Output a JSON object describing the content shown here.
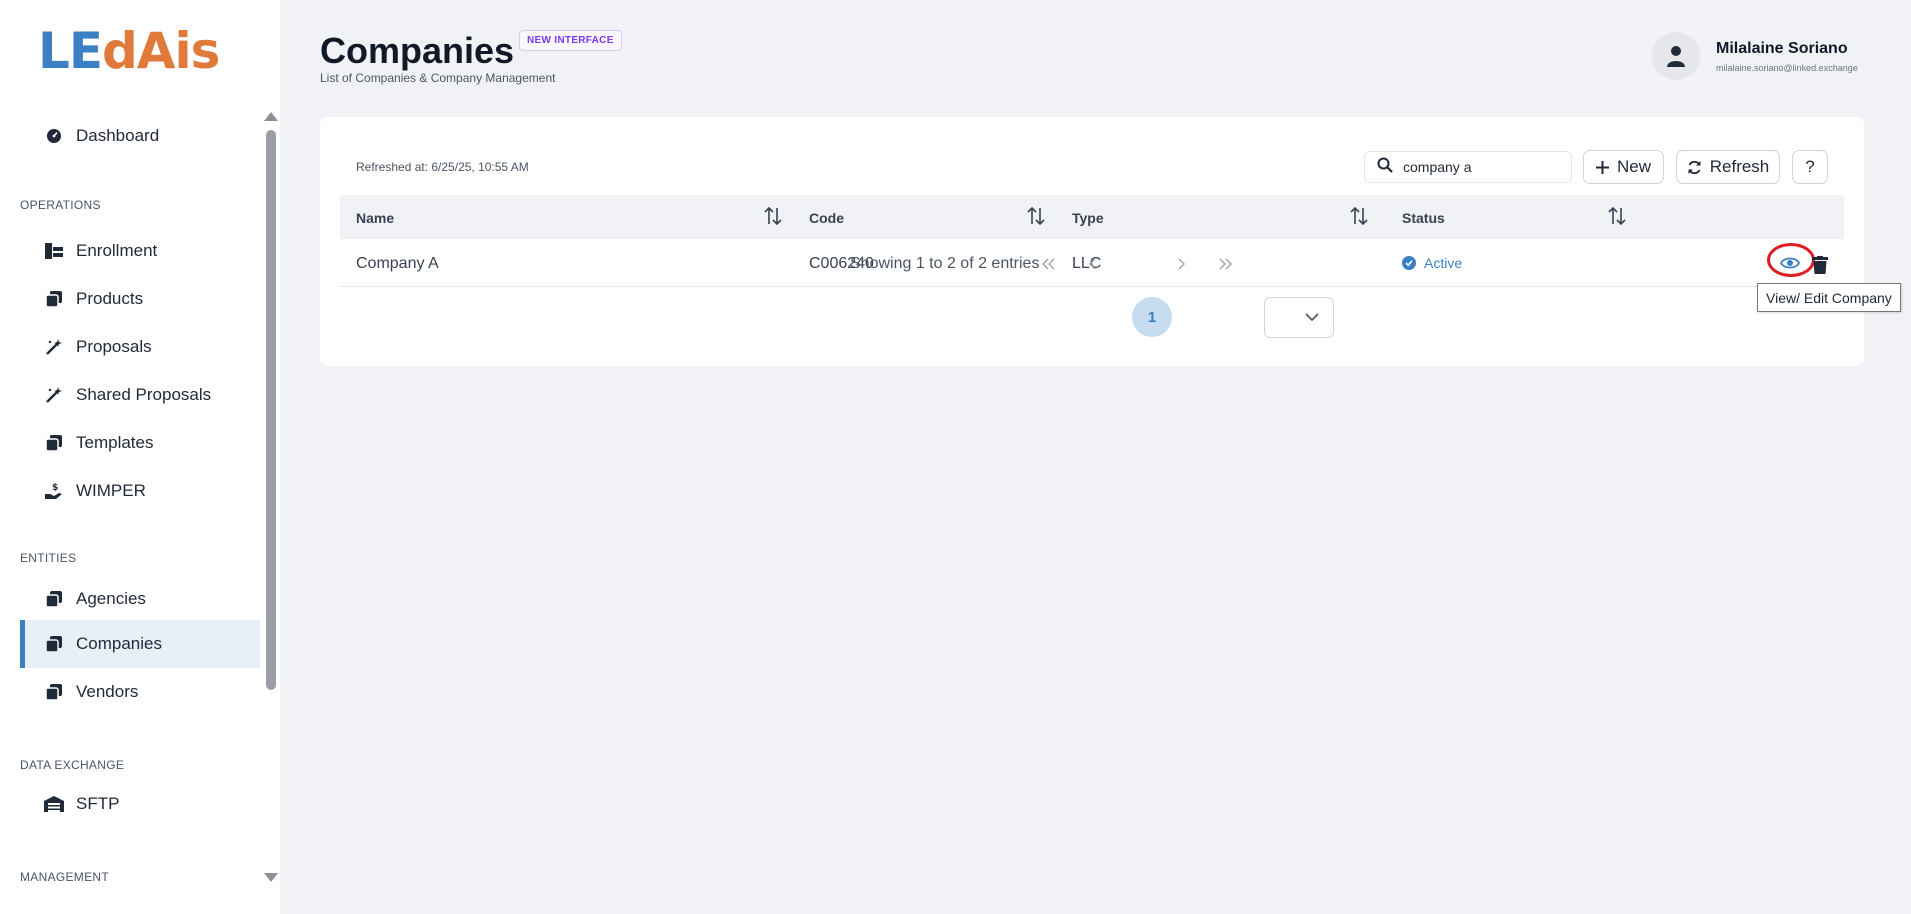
{
  "brand": {
    "logo_part1": "LE",
    "logo_part2": "dAis"
  },
  "sidebar": {
    "dashboard": "Dashboard",
    "sections": {
      "operations": "OPERATIONS",
      "entities": "ENTITIES",
      "data_exchange": "DATA EXCHANGE",
      "management": "MANAGEMENT"
    },
    "items": {
      "enrollment": "Enrollment",
      "products": "Products",
      "proposals": "Proposals",
      "shared_proposals": "Shared Proposals",
      "templates": "Templates",
      "wimper": "WIMPER",
      "agencies": "Agencies",
      "companies": "Companies",
      "vendors": "Vendors",
      "sftp": "SFTP"
    },
    "active": "companies"
  },
  "header": {
    "title": "Companies",
    "badge": "NEW INTERFACE",
    "subtitle": "List of Companies & Company Management"
  },
  "user": {
    "name": "Milalaine Soriano",
    "email": "milalaine.soriano@linked.exchange"
  },
  "toolbar": {
    "refreshed": "Refreshed at: 6/25/25, 10:55 AM",
    "search_value": "company a",
    "new_label": "New",
    "refresh_label": "Refresh",
    "help_label": "?"
  },
  "table": {
    "columns": [
      "Name",
      "Code",
      "Type",
      "Status"
    ],
    "rows": [
      {
        "name": "Company A",
        "code": "C006240",
        "type": "LLC",
        "status": "Active"
      }
    ]
  },
  "pagination": {
    "summary": "Showing 1 to 2 of 2 entries",
    "current_page": "1"
  },
  "tooltip": "View/ Edit Company",
  "colors": {
    "accent": "#3b7fc4",
    "brand_orange": "#e07a3a",
    "highlight": "#e11d23"
  }
}
